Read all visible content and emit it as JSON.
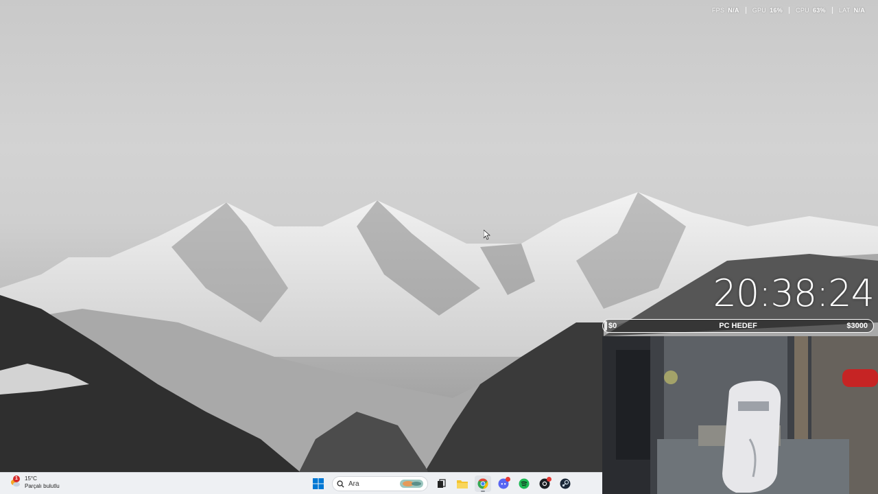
{
  "perf_overlay": [
    {
      "label": "FPS",
      "value": "N/A"
    },
    {
      "label": "GPU",
      "value": "16%"
    },
    {
      "label": "CPU",
      "value": "63%"
    },
    {
      "label": "LAT",
      "value": "N/A"
    }
  ],
  "clock": "20:38:24",
  "goal": {
    "start": "$0",
    "title": "PC HEDEF",
    "end": "$3000"
  },
  "weather": {
    "temperature": "15°C",
    "condition": "Parçalı bulutlu",
    "badge_count": "1"
  },
  "taskbar": {
    "search_placeholder": "Ara",
    "apps": [
      {
        "name": "start-button",
        "icon": "windows-icon"
      },
      {
        "name": "task-view-button",
        "icon": "task-view-icon"
      },
      {
        "name": "file-explorer-button",
        "icon": "folder-icon"
      },
      {
        "name": "chrome-button",
        "icon": "chrome-icon",
        "active": true
      },
      {
        "name": "discord-button",
        "icon": "discord-icon"
      },
      {
        "name": "spotify-button",
        "icon": "spotify-icon"
      },
      {
        "name": "github-button",
        "icon": "github-icon"
      },
      {
        "name": "steam-button",
        "icon": "steam-icon"
      }
    ]
  },
  "colors": {
    "taskbar_bg": "#eef0f3",
    "windows_blue": "#0078d4",
    "discord": "#5865f2",
    "spotify": "#1db954",
    "chrome_red": "#ea4335",
    "folder": "#f4c430"
  }
}
